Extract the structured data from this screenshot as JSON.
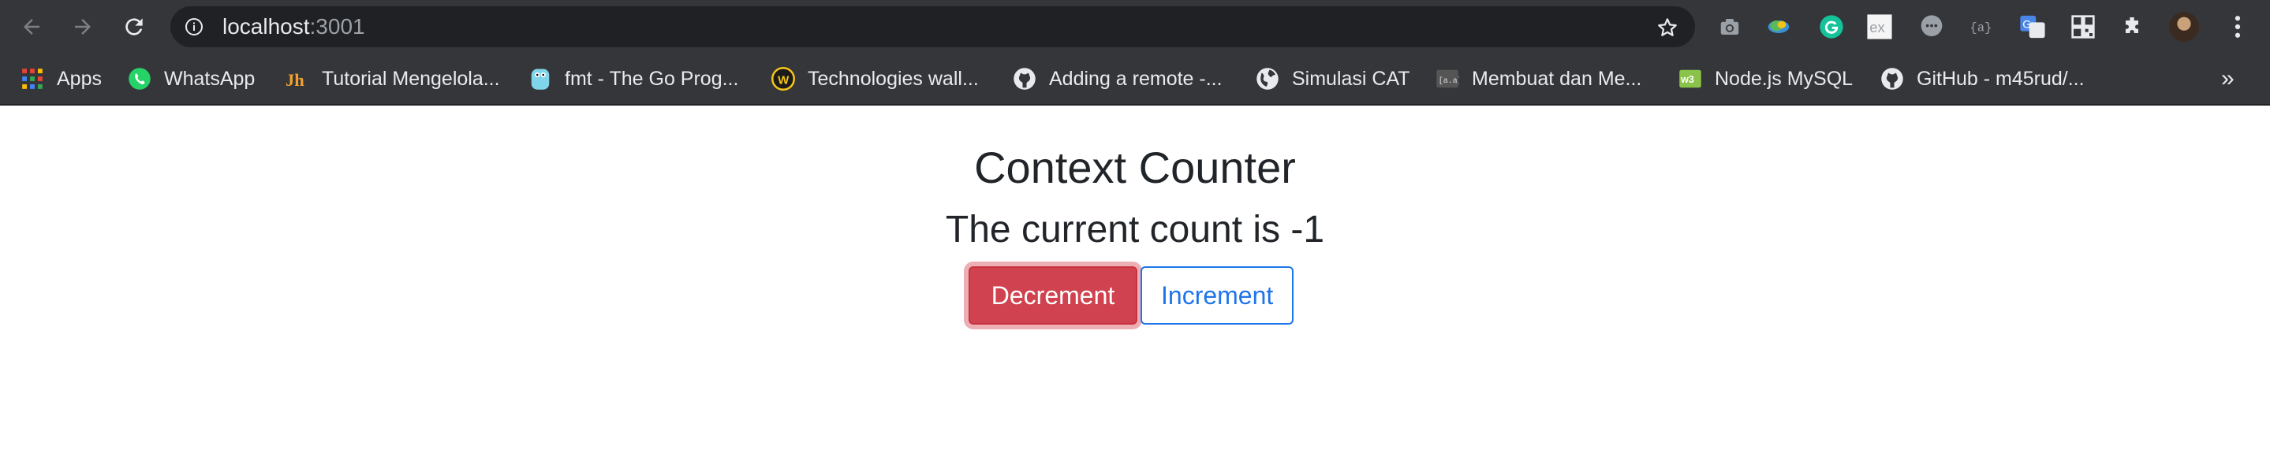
{
  "browser": {
    "url_host": "localhost",
    "url_port": ":3001",
    "bookmarks": [
      {
        "label": "Apps",
        "icon": "apps-grid-icon"
      },
      {
        "label": "WhatsApp",
        "icon": "whatsapp-icon"
      },
      {
        "label": "Tutorial Mengelola...",
        "icon": "jh-icon"
      },
      {
        "label": "fmt - The Go Prog...",
        "icon": "go-gopher-icon"
      },
      {
        "label": "Technologies wall...",
        "icon": "w-badge-icon"
      },
      {
        "label": "Adding a remote -...",
        "icon": "github-icon"
      },
      {
        "label": "Simulasi CAT",
        "icon": "globe-icon"
      },
      {
        "label": "Membuat dan Me...",
        "icon": "code-site-icon"
      },
      {
        "label": "Node.js MySQL",
        "icon": "w3schools-icon"
      },
      {
        "label": "GitHub - m45rud/...",
        "icon": "github-icon"
      }
    ],
    "more_label": "»"
  },
  "page": {
    "title": "Context Counter",
    "count_text": "The current count is -1",
    "decrement_label": "Decrement",
    "increment_label": "Increment"
  },
  "colors": {
    "chrome_bg": "#35363a",
    "omnibox_bg": "#202124",
    "danger": "#d0424f",
    "primary": "#1f75ea",
    "text": "#212529"
  }
}
